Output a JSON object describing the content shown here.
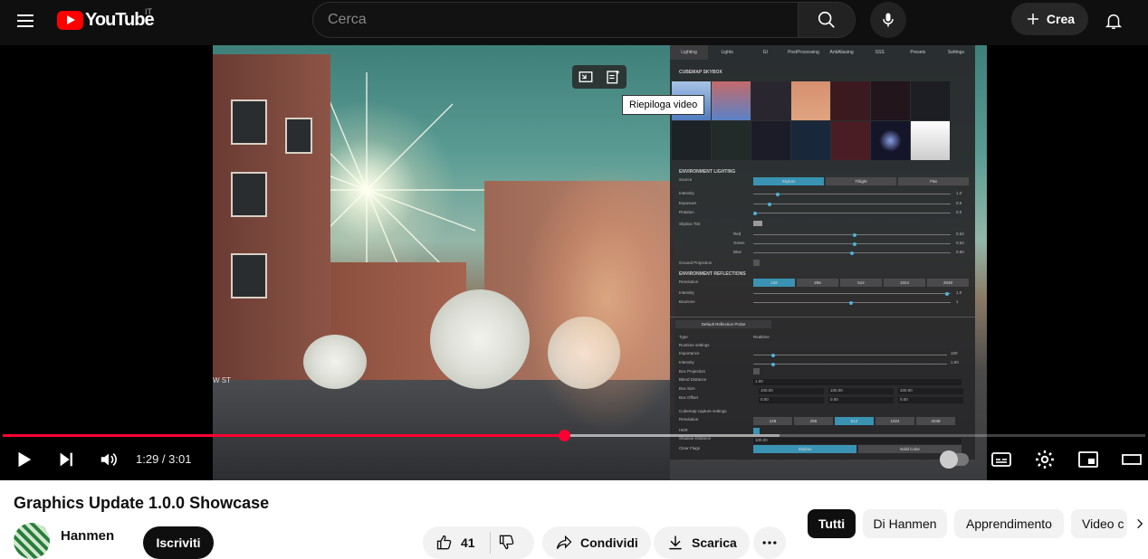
{
  "header": {
    "logo_text": "YouTube",
    "country_code": "IT",
    "search_placeholder": "Cerca",
    "create_label": "Crea"
  },
  "player": {
    "tooltip": "Riepiloga video",
    "time": "1:29 / 3:01",
    "progress_fraction": 0.492,
    "buffered_fraction": 0.68,
    "engine_panel": {
      "tabs": [
        "Lighting",
        "Lights",
        "GI",
        "PostProcessing",
        "AntiAliasing",
        "SSS",
        "Presets",
        "Settings"
      ],
      "active_tab": "Lighting",
      "cubemap_heading": "CUBEMAP SKYBOX",
      "env_lighting_heading": "ENVIRONMENT LIGHTING",
      "source_label": "Source",
      "source_options": [
        "Skybox",
        "Trilight",
        "Flat"
      ],
      "source_selected": "Skybox",
      "intensity_label": "Intensity",
      "intensity_value": "1.0",
      "exposure_label": "Exposure",
      "exposure_value": "0.6",
      "rotation_label": "Rotation",
      "rotation_value": "0.0",
      "skybox_tint_label": "Skybox Tint",
      "red_label": "Red",
      "red_value": "0.52",
      "green_label": "Green",
      "green_value": "0.52",
      "blue_label": "Blue",
      "blue_value": "0.50",
      "ground_projection_label": "Ground Projection",
      "env_reflections_heading": "ENVIRONMENT REFLECTIONS",
      "resolution_label": "Resolution",
      "resolution_options": [
        "128",
        "256",
        "512",
        "1024",
        "2048"
      ],
      "resolution_selected": "128",
      "refl_intensity_label": "Intensity",
      "refl_intensity_value": "1.0",
      "bounces_label": "Bounces",
      "bounces_value": "1",
      "probe_heading": "Default Reflection Probe",
      "type_label": "Type",
      "type_value": "Realtime",
      "runtime_label": "Runtime settings",
      "importance_label": "Importance",
      "importance_value": "100",
      "probe_intensity_label": "Intensity",
      "probe_intensity_value": "1.00",
      "box_projection_label": "Box Projection",
      "blend_distance_label": "Blend Distance",
      "blend_distance_value": "1.00",
      "box_size_label": "Box Size",
      "box_size_values": [
        "100.00",
        "100.00",
        "100.00"
      ],
      "box_offset_label": "Box Offset",
      "box_offset_values": [
        "0.00",
        "0.00",
        "0.00"
      ],
      "capture_label": "Cubemap capture settings",
      "capture_resolution_label": "Resolution",
      "capture_resolution_options": [
        "128",
        "256",
        "512",
        "1024",
        "2048"
      ],
      "capture_resolution_selected": "512",
      "hdr_label": "HDR",
      "shadow_distance_label": "Shadow Distance",
      "shadow_distance_value": "100.00",
      "clear_flags_label": "Clear Flags",
      "clear_flags_options": [
        "Skybox",
        "Solid Color"
      ],
      "clear_flags_selected": "Skybox"
    },
    "street_sign": "W ST"
  },
  "video": {
    "title": "Graphics Update 1.0.0 Showcase",
    "channel": "Hanmen",
    "subscribe_label": "Iscriviti",
    "likes": "41",
    "share_label": "Condividi",
    "download_label": "Scarica"
  },
  "chips": [
    "Tutti",
    "Di Hanmen",
    "Apprendimento",
    "Video c"
  ],
  "chips_active": "Tutti",
  "colors": {
    "accent_red": "#ff0033",
    "brand_red": "#ff0000",
    "header_bg": "#0f0f0f"
  }
}
